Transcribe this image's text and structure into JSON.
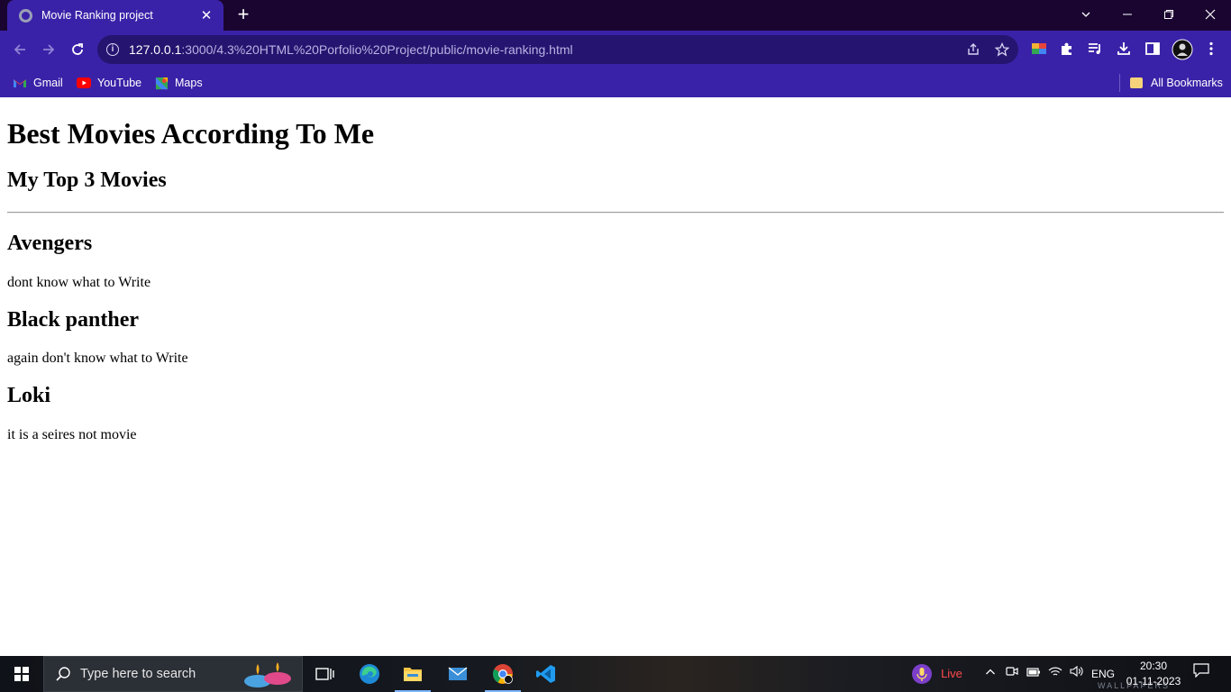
{
  "browser": {
    "tab_title": "Movie Ranking project",
    "tab_close": "✕",
    "new_tab": "+",
    "url_host": "127.0.0.1",
    "url_path": ":3000/4.3%20HTML%20Porfolio%20Project/public/movie-ranking.html",
    "bookmarks": [
      {
        "label": "Gmail",
        "icon": "gmail-icon"
      },
      {
        "label": "YouTube",
        "icon": "youtube-icon"
      },
      {
        "label": "Maps",
        "icon": "maps-icon"
      }
    ],
    "all_bookmarks": "All Bookmarks"
  },
  "page": {
    "title": "Best Movies According To Me",
    "subtitle": "My Top 3 Movies",
    "movies": [
      {
        "name": "Avengers",
        "description": "dont know what to Write"
      },
      {
        "name": "Black panther",
        "description": "again don't know what to Write"
      },
      {
        "name": "Loki",
        "description": "it is a seires not movie"
      }
    ]
  },
  "taskbar": {
    "search_placeholder": "Type here to search",
    "live_label": "Live",
    "language": "ENG",
    "time": "20:30",
    "date": "01-11-2023"
  },
  "colors": {
    "browser_frame": "#3a22a8",
    "titlebar": "#1a0530",
    "omnibox": "#251570"
  }
}
